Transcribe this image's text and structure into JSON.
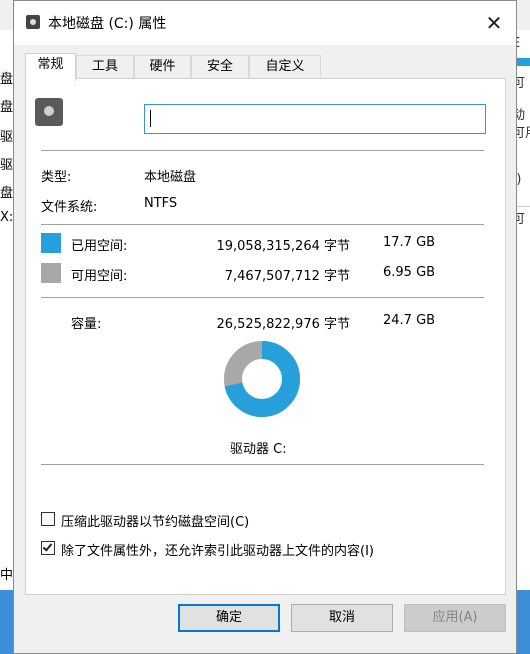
{
  "background_window": {
    "left_fragments": [
      "盘",
      "盘",
      "驱动",
      "驱动",
      "盘",
      "X:",
      "中"
    ],
    "right_fragments": [
      "E",
      "可",
      "动",
      "可用",
      ":)",
      "可"
    ]
  },
  "dialog": {
    "title": "本地磁盘 (C:) 属性",
    "close_glyph": "✕",
    "tabs": [
      "常规",
      "工具",
      "硬件",
      "安全",
      "自定义"
    ],
    "active_tab": "常规",
    "name_field": {
      "value": ""
    },
    "type_label": "类型:",
    "type_value": "本地磁盘",
    "fs_label": "文件系统:",
    "fs_value": "NTFS",
    "used": {
      "label": "已用空间:",
      "bytes": "19,058,315,264 字节",
      "size": "17.7 GB",
      "color": "#26a0da"
    },
    "free": {
      "label": "可用空间:",
      "bytes": "7,467,507,712 字节",
      "size": "6.95 GB",
      "color": "#a8a8a8"
    },
    "capacity": {
      "label": "容量:",
      "bytes": "26,525,822,976 字节",
      "size": "24.7 GB"
    },
    "used_fraction": 0.7185,
    "drive_label": "驱动器 C:",
    "compress": {
      "label": "压缩此驱动器以节约磁盘空间(C)",
      "checked": false
    },
    "index": {
      "label": "除了文件属性外，还允许索引此驱动器上文件的内容(I)",
      "checked": true
    },
    "buttons": {
      "ok": "确定",
      "cancel": "取消",
      "apply": "应用(A)"
    }
  }
}
